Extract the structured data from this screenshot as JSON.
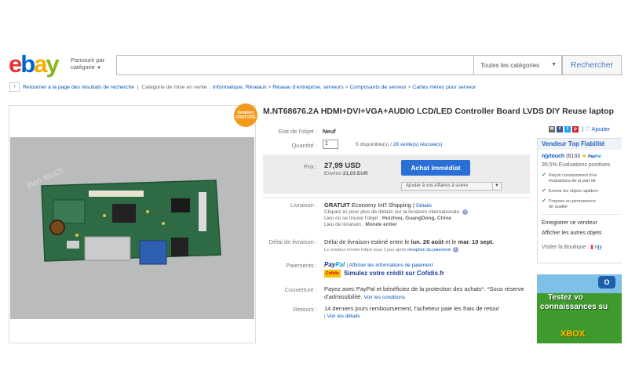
{
  "header": {
    "logo": {
      "e": "e",
      "b": "b",
      "a": "a",
      "y": "y"
    },
    "browse_label_1": "Parcourir par",
    "browse_label_2": "catégorie",
    "category_select": "Toutes les catégories",
    "search_button": "Rechercher",
    "search_placeholder": ""
  },
  "breadcrumb": {
    "back": "Retourner à la page des résultats de recherche",
    "listed_in": "Catégorie de mise en vente :",
    "items": [
      "Informatique, Réseaux",
      "Réseau d'entreprise, serveurs",
      "Composants de serveur",
      "Cartes mères pour serveur"
    ],
    "separator": ">"
  },
  "listing": {
    "badge_line1": "livraison",
    "badge_line2": "GRATUITE",
    "photo_watermark": "Ben touch",
    "title": "M.NT68676.2A HDMI+DVI+VGA+AUDIO LCD/LED Controller Board LVDS DIY Reuse laptop",
    "condition_label": "Etat de l'objet :",
    "condition": "Neuf",
    "quantity_label": "Quantité :",
    "quantity": "1",
    "available": "5 disponible(s)",
    "sold": "28 vente(s) réussie(s)",
    "price_label": "Prix :",
    "price": "27,99 USD",
    "approx": "Environ",
    "approx_value": "21,03 EUR",
    "buy_now": "Achat immédiat",
    "watch": "Ajouter à vos Affaires à suivre",
    "shipping_label": "Livraison :",
    "shipping_free": "GRATUIT",
    "shipping_method": "Economy Int'l Shipping",
    "shipping_details": "Détails",
    "shipping_line2": "Cliquez ici pour plus de détails sur la livraison internationale.",
    "item_location_label": "Lieu où se trouve l'objet :",
    "item_location": "Huizhou, GuangDong, Chine",
    "ships_to_label": "Lieu de livraison :",
    "ships_to": "Monde entier",
    "delivery_label": "Délai de livraison :",
    "delivery_text": "Délai de livraison estimé entre le",
    "delivery_date1": "lun. 26 août",
    "delivery_and": "et le",
    "delivery_date2": "mar. 10 sept.",
    "delivery_note": "Le vendeur envoie l'objet sous 1 jour après",
    "delivery_note_link": "réception du paiement.",
    "payments_label": "Paiements :",
    "paypal_pay": "Pay",
    "paypal_pal": "Pal",
    "paypal_info": "Afficher les informations de paiement",
    "cofidis_logo": "Cofidis",
    "cofidis_text": "Simulez votre crédit sur Cofidis.fr",
    "coverage_label": "Couverture :",
    "coverage_text": "Payez avec PayPal et bénéficiez de la protection des achats*. *Sous réserve d'admissibilité.",
    "coverage_link": "Voir les conditions",
    "returns_label": "Retours :",
    "returns_text": "14 derniers jours remboursement, l'acheteur paie les frais de retour",
    "returns_link": "Voir les détails"
  },
  "share": {
    "add": "Ajouter"
  },
  "seller": {
    "header": "Vendeur Top Fiabilité",
    "name": "njytouch",
    "feedback": "(6133",
    "positive": "99,5% Evaluations positives",
    "perk1a": "Reçoit constamment d'ex",
    "perk1b": "évaluations de la part de",
    "perk2": "Envoie les objets rapidem",
    "perk3a": "Propose en permanence",
    "perk3b": "de qualité",
    "save": "Enregistrer ce vendeur",
    "other_items": "Afficher les autres objets",
    "store_label": "Visiter la Boutique :",
    "store": "njy"
  },
  "ad": {
    "brand": "O",
    "line1": "Testez vo",
    "line2": "connaissances su",
    "line3": "XBOX"
  },
  "colors": {
    "accent": "#2a6fd6",
    "link": "#0654ba",
    "ebay_red": "#e53238",
    "ebay_blue": "#0064d2",
    "ebay_yellow": "#f5af02",
    "ebay_green": "#86b817"
  }
}
